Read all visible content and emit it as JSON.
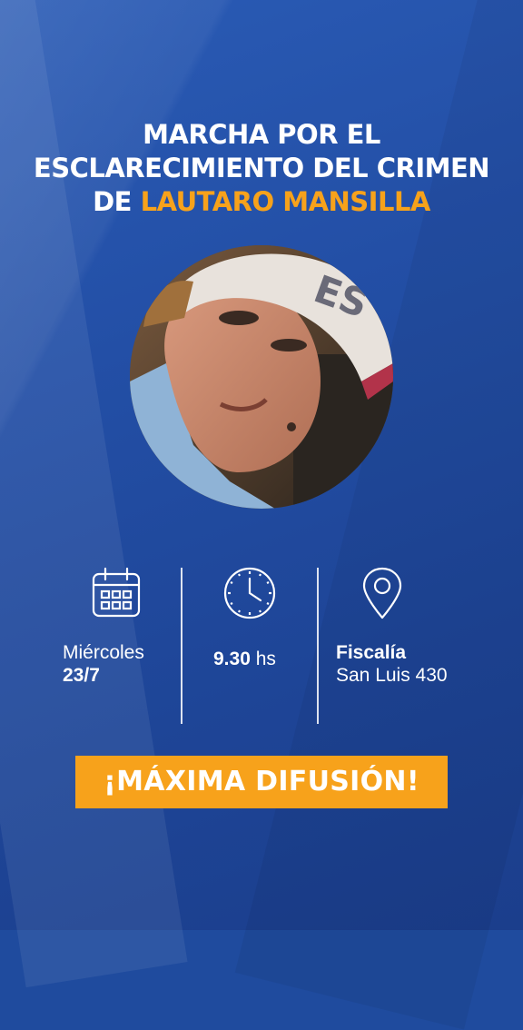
{
  "headline": {
    "line1": "MARCHA POR EL",
    "line2": "ESCLARECIMIENTO DEL CRIMEN",
    "line3_prefix": "DE ",
    "line3_name": "LAUTARO MANSILLA"
  },
  "details": {
    "date": {
      "icon": "calendar-icon",
      "day": "Miércoles",
      "date": "23/7"
    },
    "time": {
      "icon": "clock-icon",
      "value": "9.30",
      "unit": "hs"
    },
    "place": {
      "icon": "location-pin-icon",
      "name": "Fiscalía",
      "address": "San Luis 430"
    }
  },
  "banner": {
    "text": "¡MÁXIMA DIFUSIÓN!"
  },
  "colors": {
    "background": "#1f4b9e",
    "accent": "#f7a21b",
    "text": "#ffffff"
  }
}
